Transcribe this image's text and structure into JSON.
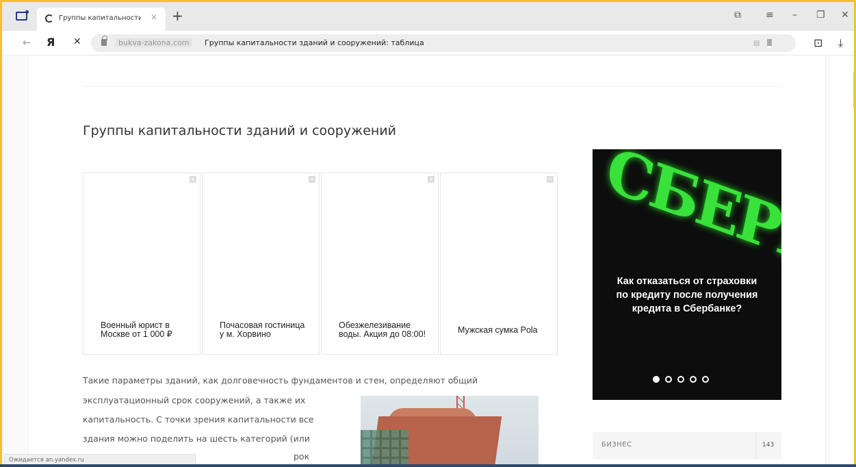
{
  "browser": {
    "tab_title": "Группы капитальности",
    "tab_close": "×",
    "new_tab": "+",
    "domain": "bukva-zakona.com",
    "page_title": "Группы капитальности зданий и сооружений: таблица",
    "ya_logo": "Я",
    "status_text": "Ожидается an.yandex.ru",
    "back_icon": "←",
    "stop_icon": "✕",
    "window_controls": [
      "⧉",
      "≡",
      "–",
      "❐",
      "✕"
    ],
    "right_icons": [
      "⊡",
      "⤓"
    ]
  },
  "article": {
    "title": "Группы капитальности зданий и сооружений",
    "lines": [
      "Такие параметры зданий, как долговечность фундаментов и стен, определяют общий",
      "эксплуатационный срок сооружений, а также их",
      "капитальность. С точки зрения капитальности все",
      "здания можно поделить на шесть категорий (или",
      "рок"
    ]
  },
  "ads": [
    {
      "text": "Военный юрист в Москве от 1 000 ₽"
    },
    {
      "text": "Почасовая гостиница у м. Хорвино"
    },
    {
      "text": "Обезжелезивание воды. Акция до 08:00!"
    },
    {
      "text": "Мужская сумка Pola"
    }
  ],
  "sidebar": {
    "promo": {
      "sign": "СБЕРБАН",
      "title": "Как отказаться от страховки по кредиту после получения кредита в Сбербанке?",
      "slide_count": 5,
      "active_slide": 1
    },
    "category": {
      "name": "БИЗНЕС",
      "count": "143"
    }
  },
  "colors": {
    "accent_frame": "#f2c12e",
    "promo_green": "#39e23a"
  }
}
